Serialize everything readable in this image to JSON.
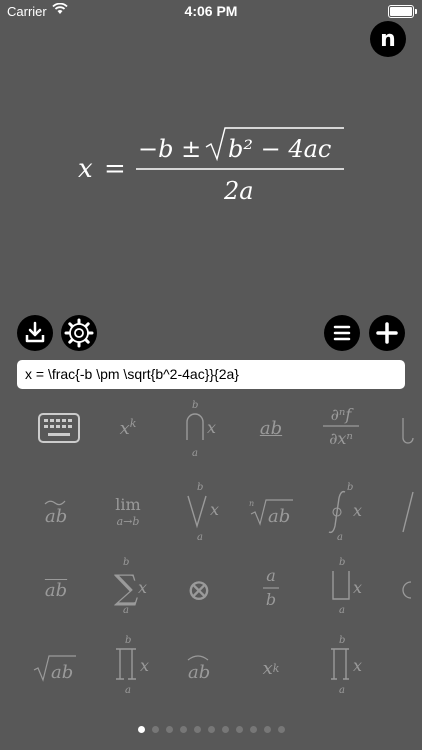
{
  "status": {
    "carrier": "Carrier",
    "time": "4:06 PM"
  },
  "top_button": {
    "label": "n"
  },
  "formula": {
    "lhs": "x",
    "equals": "=",
    "numerator": "−b ±",
    "radicand": "b² − 4ac",
    "denominator": "2a"
  },
  "toolbar": {
    "icons": [
      "download-icon",
      "gear-icon",
      "list-icon",
      "plus-icon"
    ]
  },
  "latex_input": {
    "value": "x = \\frac{-b \\pm \\sqrt{b^2-4ac}}{2a}"
  },
  "palette": {
    "row1": {
      "power": "x",
      "power_sup": "k",
      "intersection_var": "x",
      "intersection_top": "b",
      "intersection_bottom": "a",
      "underline": "ab",
      "partial_num": "∂ⁿf",
      "partial_den": "∂xⁿ"
    },
    "row2": {
      "widetilde": "ab",
      "lim": "lim",
      "lim_sub": "a→b",
      "vee_var": "x",
      "vee_top": "b",
      "vee_bottom": "a",
      "nroot": "ab",
      "nroot_index": "n",
      "oint_var": "x",
      "oint_top": "b",
      "oint_bottom": "a"
    },
    "row3": {
      "overline": "ab",
      "sum_var": "x",
      "sum_top": "b",
      "sum_bottom": "a",
      "otimes": "⊗",
      "frac_top": "a",
      "frac_bottom": "b",
      "coprod_var": "x",
      "coprod_top": "b",
      "coprod_bottom": "a"
    },
    "row4": {
      "sqrt": "ab",
      "prod_var": "x",
      "prod_top": "b",
      "prod_bottom": "a",
      "widehat": "ab",
      "subscript": "x",
      "subscript_sub": "k",
      "bigamalg_var": "x",
      "bigamalg_top": "b",
      "bigamalg_bottom": "a"
    }
  },
  "pager": {
    "page_count": 11,
    "current_page": 1
  },
  "colors": {
    "background": "#585858",
    "symbol": "#9a9a9a",
    "button": "#000000"
  }
}
